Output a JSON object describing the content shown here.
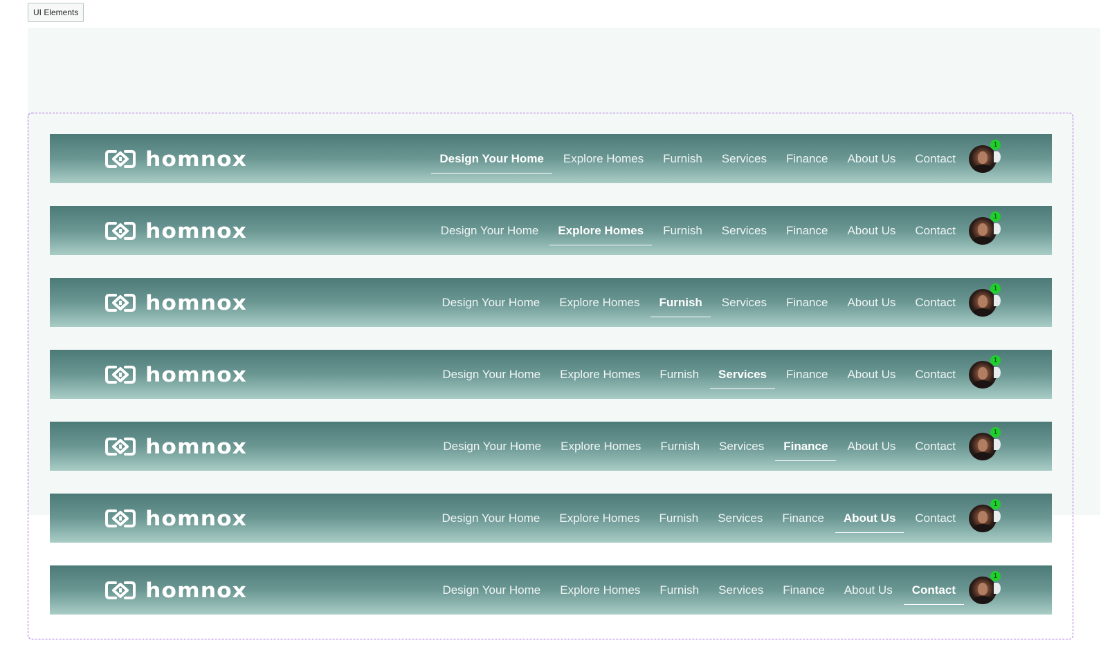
{
  "frame_label": "UI Elements",
  "brand": {
    "name": "homnox",
    "logo_icon": "homnox-logo-icon"
  },
  "nav_items": [
    "Design Your Home",
    "Explore Homes",
    "Furnish",
    "Services",
    "Finance",
    "About Us",
    "Contact"
  ],
  "variants": [
    {
      "active_index": 0
    },
    {
      "active_index": 1
    },
    {
      "active_index": 2
    },
    {
      "active_index": 3
    },
    {
      "active_index": 4
    },
    {
      "active_index": 5
    },
    {
      "active_index": 6
    }
  ],
  "notification_count": "1",
  "avatar_icon": "user-avatar",
  "colors": {
    "nav_gradient_top": "#4c7a77",
    "nav_gradient_bottom": "#a9cdc6",
    "badge": "#1fcf2c",
    "frame_dashed": "#a66ae0",
    "canvas_bg": "#f4f8f7"
  }
}
